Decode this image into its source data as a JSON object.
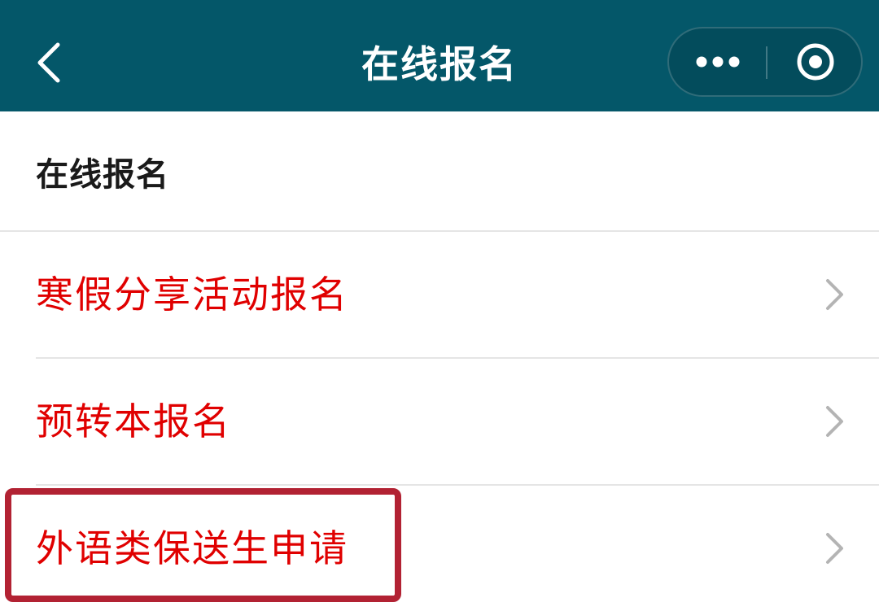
{
  "header": {
    "title": "在线报名",
    "background_color": "#045769",
    "back_icon": "chevron-left-icon",
    "more_icon": "more-dots-icon",
    "close_icon": "target-circle-icon"
  },
  "section": {
    "title": "在线报名"
  },
  "list": {
    "item_color": "#e00000",
    "chevron_icon": "chevron-right-icon",
    "items": [
      {
        "label": "寒假分享活动报名"
      },
      {
        "label": "预转本报名"
      },
      {
        "label": "外语类保送生申请"
      }
    ]
  },
  "highlight": {
    "color": "#b22233",
    "target": "外语类保送生申请"
  }
}
